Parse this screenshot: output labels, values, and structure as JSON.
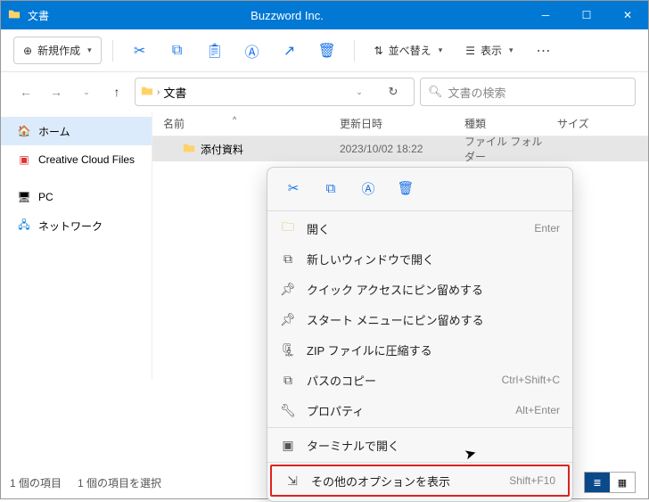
{
  "window": {
    "title": "文書",
    "brand": "Buzzword Inc."
  },
  "toolbar": {
    "new_label": "新規作成",
    "sort_label": "並べ替え",
    "view_label": "表示"
  },
  "address": {
    "crumb": "文書"
  },
  "search": {
    "placeholder": "文書の検索"
  },
  "sidebar": {
    "items": [
      {
        "label": "ホーム"
      },
      {
        "label": "Creative Cloud Files"
      },
      {
        "label": "PC"
      },
      {
        "label": "ネットワーク"
      }
    ]
  },
  "columns": {
    "name": "名前",
    "date": "更新日時",
    "type": "種類",
    "size": "サイズ"
  },
  "rows": [
    {
      "name": "添付資料",
      "date": "2023/10/02 18:22",
      "type": "ファイル フォルダー"
    }
  ],
  "status": {
    "count": "1 個の項目",
    "selected": "1 個の項目を選択"
  },
  "context_menu": {
    "items": [
      {
        "label": "開く",
        "shortcut": "Enter"
      },
      {
        "label": "新しいウィンドウで開く",
        "shortcut": ""
      },
      {
        "label": "クイック アクセスにピン留めする",
        "shortcut": ""
      },
      {
        "label": "スタート メニューにピン留めする",
        "shortcut": ""
      },
      {
        "label": "ZIP ファイルに圧縮する",
        "shortcut": ""
      },
      {
        "label": "パスのコピー",
        "shortcut": "Ctrl+Shift+C"
      },
      {
        "label": "プロパティ",
        "shortcut": "Alt+Enter"
      },
      {
        "label": "ターミナルで開く",
        "shortcut": ""
      },
      {
        "label": "その他のオプションを表示",
        "shortcut": "Shift+F10"
      }
    ]
  }
}
